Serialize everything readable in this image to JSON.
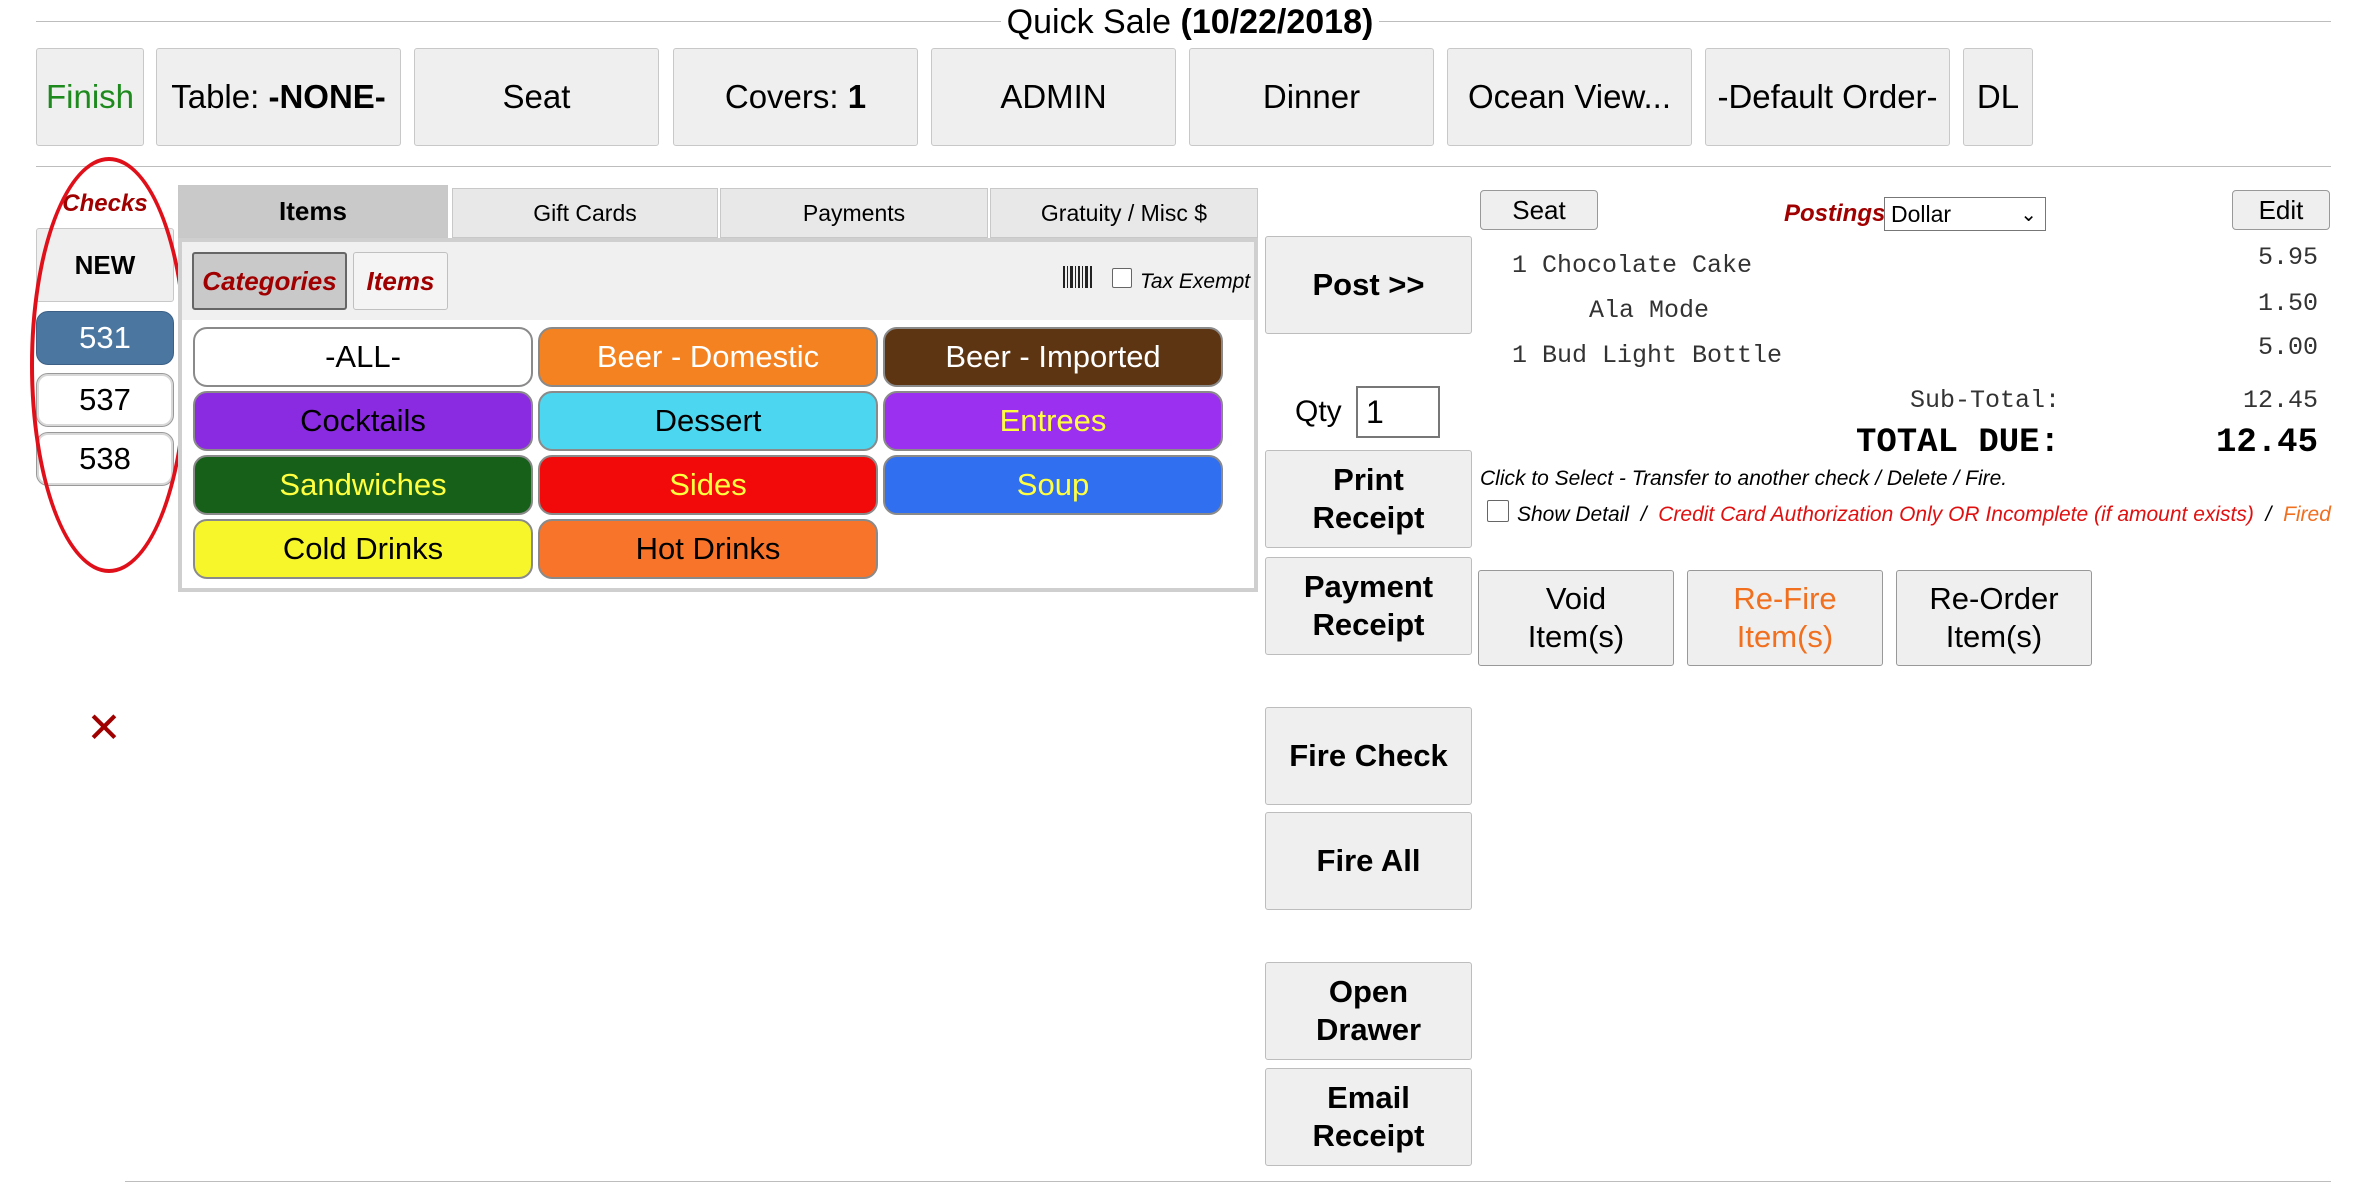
{
  "header": {
    "title_prefix": "Quick Sale",
    "title_date": "(10/22/2018)"
  },
  "topbar": {
    "finish": "Finish",
    "table_label": "Table:",
    "table_value": "-NONE-",
    "seat": "Seat",
    "covers_label": "Covers:",
    "covers_value": "1",
    "server": "ADMIN",
    "meal_period": "Dinner",
    "location": "Ocean View...",
    "order_type": "-Default Order-",
    "dl": "DL"
  },
  "checks": {
    "label": "Checks",
    "new": "NEW",
    "items": [
      "531",
      "537",
      "538"
    ]
  },
  "tabs": [
    "Items",
    "Gift Cards",
    "Payments",
    "Gratuity / Misc $"
  ],
  "subtabs": [
    "Categories",
    "Items"
  ],
  "tax_exempt_label": "Tax Exempt",
  "categories": [
    {
      "label": "-ALL-",
      "bg": "#ffffff",
      "fg": "#000000"
    },
    {
      "label": "Beer - Domestic",
      "bg": "#f58220",
      "fg": "#ffffff"
    },
    {
      "label": "Beer - Imported",
      "bg": "#5e3512",
      "fg": "#ffffff"
    },
    {
      "label": "Cocktails",
      "bg": "#8a2be2",
      "fg": "#000000"
    },
    {
      "label": "Dessert",
      "bg": "#4dd6ef",
      "fg": "#000000"
    },
    {
      "label": "Entrees",
      "bg": "#9b30f0",
      "fg": "#ffff40"
    },
    {
      "label": "Sandwiches",
      "bg": "#16601a",
      "fg": "#ffff40"
    },
    {
      "label": "Sides",
      "bg": "#f20a0a",
      "fg": "#ffff40"
    },
    {
      "label": "Soup",
      "bg": "#2f6ff0",
      "fg": "#ffff40"
    },
    {
      "label": "Cold Drinks",
      "bg": "#f6f62a",
      "fg": "#000000"
    },
    {
      "label": "Hot Drinks",
      "bg": "#f8742a",
      "fg": "#000000"
    }
  ],
  "actions": {
    "post": "Post >>",
    "qty_label": "Qty",
    "qty_value": "1",
    "print_receipt_1": "Print",
    "print_receipt_2": "Receipt",
    "payment_receipt_1": "Payment",
    "payment_receipt_2": "Receipt",
    "fire_check": "Fire Check",
    "fire_all": "Fire All",
    "open_drawer_1": "Open",
    "open_drawer_2": "Drawer",
    "email_receipt_1": "Email",
    "email_receipt_2": "Receipt"
  },
  "order": {
    "seat_button": "Seat",
    "postings_label": "Postings",
    "postings_value": "Dollar",
    "edit_button": "Edit",
    "lines": [
      {
        "text": "1 Chocolate Cake",
        "price": "5.95"
      },
      {
        "text": "Ala Mode",
        "price": "1.50"
      },
      {
        "text": "1 Bud Light Bottle",
        "price": "5.00"
      }
    ],
    "subtotal_label": "Sub-Total:",
    "subtotal_value": "12.45",
    "total_label": "TOTAL DUE:",
    "total_value": "12.45",
    "hint": "Click to Select - Transfer to another check / Delete / Fire.",
    "show_detail": "Show Detail",
    "legend_sep": "/",
    "legend_red": "Credit Card Authorization Only OR Incomplete (if amount exists)",
    "legend_orange": "Fired"
  },
  "item_buttons": {
    "void_1": "Void",
    "void_2": "Item(s)",
    "refire_1": "Re-Fire",
    "refire_2": "Item(s)",
    "reorder_1": "Re-Order",
    "reorder_2": "Item(s)"
  },
  "colors": {
    "accent_red": "#a00000",
    "finish_green": "#1e8a1e",
    "active_check": "#4a76a0",
    "fired_orange": "#f07020"
  }
}
